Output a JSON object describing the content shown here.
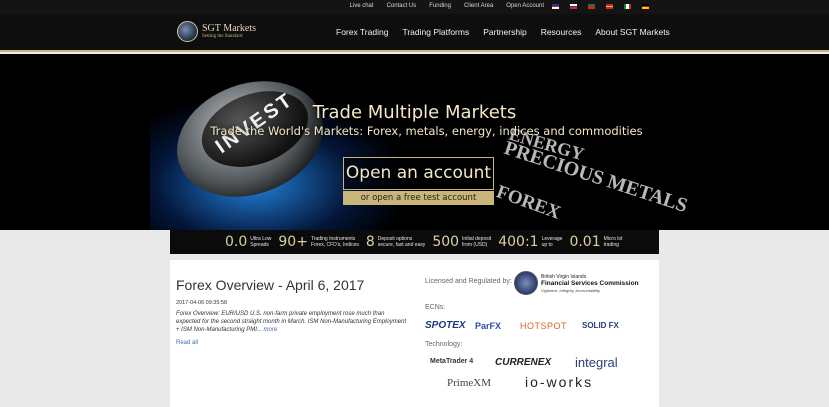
{
  "topbar": {
    "links": [
      "Live chat",
      "Contact Us",
      "Funding",
      "Client Area",
      "Open Account"
    ],
    "languages": [
      "en",
      "ru",
      "pt",
      "es",
      "it",
      "de"
    ]
  },
  "logo": {
    "name": "SGT Markets",
    "tagline": "Setting the Standard"
  },
  "nav": {
    "items": [
      "Forex Trading",
      "Trading Platforms",
      "Partnership",
      "Resources",
      "About SGT Markets"
    ]
  },
  "hero": {
    "knob_word": "INVEST",
    "deco_words": [
      "ENERGY",
      "PRECIOUS METALS",
      "FOREX"
    ],
    "headline": "Trade Multiple Markets",
    "subheadline": "Trade the World's Markets: Forex, metals, energy, indices and commodities",
    "open_account_label": "Open an account",
    "test_account_label": "or open a free test account"
  },
  "stats": [
    {
      "num": "0.0",
      "l1": "Ultra Low",
      "l2": "Spreads"
    },
    {
      "num": "90+",
      "l1": "Trading Instruments",
      "l2": "Forex, CFD's, Indices"
    },
    {
      "num": "8",
      "l1": "Deposit options",
      "l2": "secure, fast and easy"
    },
    {
      "num": "500",
      "l1": "Initial deposit",
      "l2": "from (USD)"
    },
    {
      "num": "400:1",
      "l1": "Leverage",
      "l2": "up to"
    },
    {
      "num": "0.01",
      "l1": "Micro lot",
      "l2": "trading"
    }
  ],
  "post": {
    "title": "Forex Overview - April 6, 2017",
    "date": "2017-04-06 09:35:58",
    "excerpt": "Forex Overview: EUR/USD U.S. non-farm private employment rose much than expected for the second straight month in March. ISM Non-Manufacturing Employment + ISM Non-Manufacturing PMI...",
    "more": "more",
    "read_all": "Read all"
  },
  "sidebar": {
    "licensed_label": "Licensed and Regulated by:",
    "regulator": {
      "line1": "British Virgin Islands",
      "line2": "Financial Services Commission",
      "motto": "Vigilance, Integrity, Accountability"
    },
    "ecns_label": "ECNs:",
    "ecns": [
      "SPOTEX",
      "ParFX",
      "HOTSPOT",
      "SOLID FX"
    ],
    "technology_label": "Technology:",
    "technology": [
      "MetaTrader 4",
      "CURRENEX",
      "integral",
      "PrimeXM",
      "io-works"
    ]
  },
  "colors": {
    "gold": "#c9b47a",
    "dark": "#0e0e0e",
    "link": "#3d6ea8"
  }
}
